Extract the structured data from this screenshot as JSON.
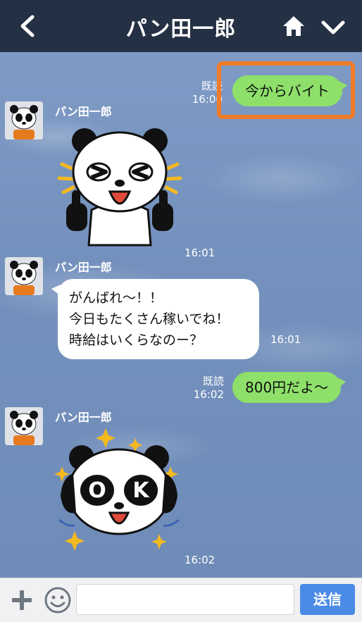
{
  "header": {
    "title": "パン田一郎",
    "back_icon": "chevron-left-icon",
    "home_icon": "home-icon",
    "menu_icon": "chevron-down-icon",
    "bg_color": "#243043"
  },
  "messages": [
    {
      "type": "sent-text",
      "read": "既読",
      "time": "16:00",
      "text": "今からバイト",
      "highlighted": true
    },
    {
      "type": "received-sticker",
      "sender": "パン田一郎",
      "sticker": "panda-thumbs-up-sticker",
      "time": "16:01"
    },
    {
      "type": "received-text",
      "sender": "パン田一郎",
      "lines": [
        "がんばれ〜！！",
        "今日もたくさん稼いでね！",
        "時給はいくらなのー？"
      ],
      "time": "16:01"
    },
    {
      "type": "sent-text",
      "read": "既読",
      "time": "16:02",
      "text": "800円だよ〜"
    },
    {
      "type": "received-sticker",
      "sender": "パン田一郎",
      "sticker": "panda-ok-sticker",
      "sticker_text": "OK",
      "time": "16:02"
    }
  ],
  "input": {
    "placeholder": "",
    "send_label": "送信",
    "plus_icon": "plus-icon",
    "emoji_icon": "smiley-icon"
  },
  "colors": {
    "sent_bubble": "#8ee06a",
    "received_bubble": "#ffffff",
    "send_button": "#4b8be8",
    "highlight": "#f07b28"
  }
}
